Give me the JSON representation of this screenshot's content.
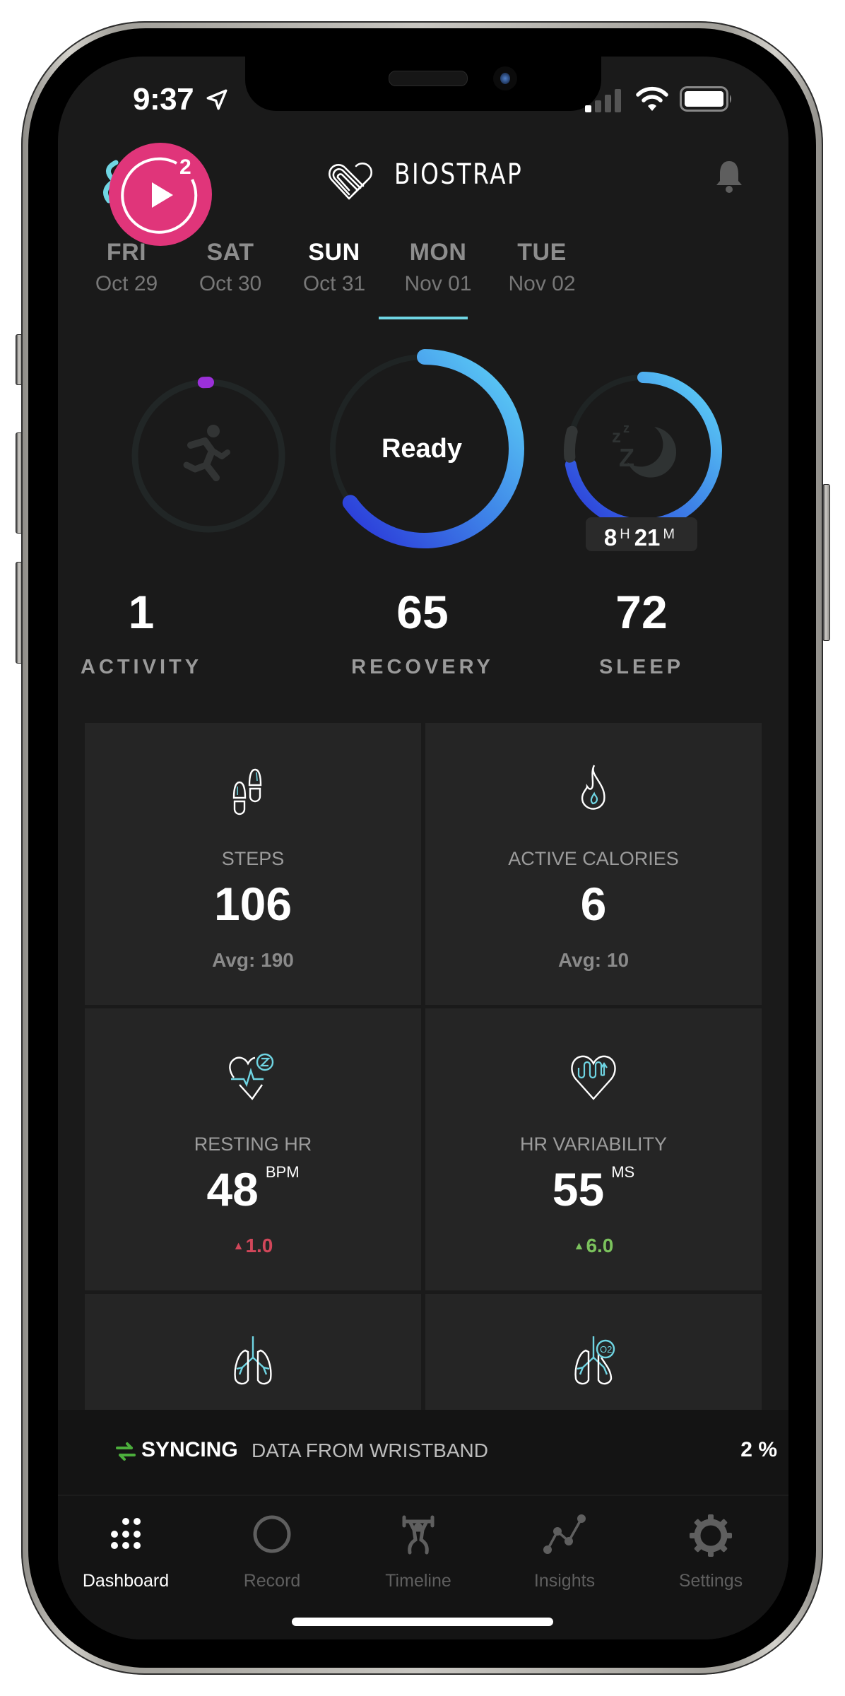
{
  "status_bar": {
    "time": "9:37",
    "location_icon": "location-arrow-icon",
    "signal_icon": "cellular-signal-icon",
    "wifi_icon": "wifi-icon",
    "battery_icon": "battery-icon"
  },
  "header": {
    "live_badge_count": "2",
    "live_badge_icon": "play-icon",
    "brand": "BIOSTRAP",
    "logo_icon": "biostrap-heart-logo",
    "notification_icon": "bell-icon"
  },
  "days": [
    {
      "dow": "FRI",
      "date": "Oct 29",
      "active": false
    },
    {
      "dow": "SAT",
      "date": "Oct 30",
      "active": false
    },
    {
      "dow": "SUN",
      "date": "Oct 31",
      "active": true
    },
    {
      "dow": "MON",
      "date": "Nov 01",
      "active": false
    },
    {
      "dow": "TUE",
      "date": "Nov 02",
      "active": false
    }
  ],
  "scores": {
    "activity": {
      "value": "1",
      "label": "ACTIVITY",
      "ring_fraction": 0.01,
      "icon": "running-person-icon"
    },
    "recovery": {
      "value": "65",
      "label": "RECOVERY",
      "ring_fraction": 0.65,
      "status": "Ready"
    },
    "sleep": {
      "value": "72",
      "label": "SLEEP",
      "ring_fraction": 0.72,
      "icon": "moon-zzz-icon",
      "duration_h": "8",
      "duration_h_unit": "H",
      "duration_m": "21",
      "duration_m_unit": "M"
    }
  },
  "tiles": [
    {
      "id": "steps",
      "label": "STEPS",
      "value": "106",
      "unit": "",
      "sub": "Avg: 190",
      "sub_type": "avg",
      "icon": "footsteps-icon"
    },
    {
      "id": "active-calories",
      "label": "ACTIVE CALORIES",
      "value": "6",
      "unit": "",
      "sub": "Avg: 10",
      "sub_type": "avg",
      "icon": "flame-icon"
    },
    {
      "id": "resting-hr",
      "label": "RESTING HR",
      "value": "48",
      "unit": "BPM",
      "sub": "1.0",
      "sub_type": "up-red",
      "icon": "heart-pulse-sleep-icon"
    },
    {
      "id": "hr-variability",
      "label": "HR VARIABILITY",
      "value": "55",
      "unit": "MS",
      "sub": "6.0",
      "sub_type": "up-green",
      "icon": "heart-wave-icon"
    },
    {
      "id": "respiratory-rate",
      "label": "",
      "value": "",
      "unit": "",
      "sub": "",
      "sub_type": "",
      "icon": "lungs-icon"
    },
    {
      "id": "spo2",
      "label": "",
      "value": "",
      "unit": "",
      "sub": "",
      "sub_type": "",
      "icon": "lungs-o2-icon"
    }
  ],
  "sync": {
    "strong": "SYNCING",
    "rest": "DATA FROM WRISTBAND",
    "percent": "2 %",
    "progress_percent": 2,
    "icon": "sync-arrows-icon"
  },
  "tabbar": {
    "items": [
      {
        "label": "Dashboard",
        "icon": "dashboard-dots-icon",
        "active": true
      },
      {
        "label": "Record",
        "icon": "record-circle-icon",
        "active": false
      },
      {
        "label": "Timeline",
        "icon": "weightlifter-icon",
        "active": false
      },
      {
        "label": "Insights",
        "icon": "line-chart-icon",
        "active": false
      },
      {
        "label": "Settings",
        "icon": "gear-icon",
        "active": false
      }
    ]
  },
  "colors": {
    "accent_cyan": "#6fd5e3",
    "live_pink": "#e0357a",
    "activity_purple": "#9b30d9",
    "ring_blue_start": "#2a36d8",
    "ring_blue_end": "#5fd6f7",
    "down_red": "#d2475a",
    "up_green": "#7bc25d"
  }
}
